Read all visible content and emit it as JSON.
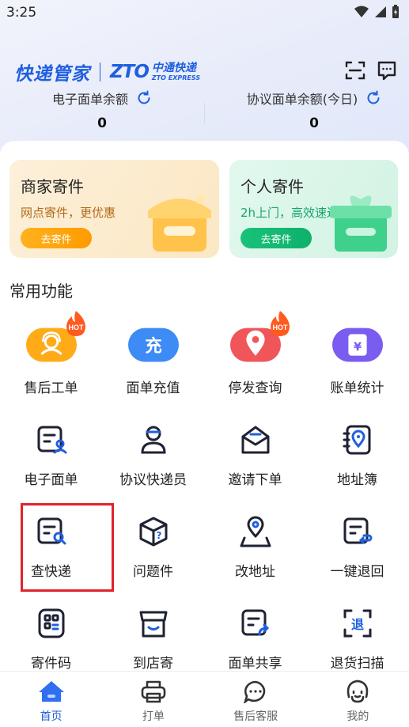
{
  "status_bar": {
    "time": "3:25"
  },
  "header": {
    "brand_name": "快递管家",
    "brand_zto": "ZTO",
    "brand_cn": "中通快递",
    "brand_en": "ZTO EXPRESS"
  },
  "balances": {
    "electronic_label": "电子面单余额",
    "electronic_value": "0",
    "agreement_label": "协议面单余额(今日)",
    "agreement_value": "0"
  },
  "promos": {
    "merchant": {
      "title": "商家寄件",
      "subtitle": "网点寄件，更优惠",
      "button": "去寄件"
    },
    "personal": {
      "title": "个人寄件",
      "subtitle": "2h上门，高效速达",
      "button": "去寄件"
    }
  },
  "functions": {
    "title": "常用功能",
    "hot_badge": "HOT",
    "charge_glyph": "充",
    "bill_glyph": "¥",
    "return_glyph": "退",
    "items": [
      {
        "label": "售后工单",
        "icon": "headset-icon",
        "hot": true
      },
      {
        "label": "面单充值",
        "icon": "recharge-icon",
        "hot": false
      },
      {
        "label": "停发查询",
        "icon": "location-pin-icon",
        "hot": true
      },
      {
        "label": "账单统计",
        "icon": "bill-icon",
        "hot": false
      },
      {
        "label": "电子面单",
        "icon": "e-waybill-icon",
        "hot": false
      },
      {
        "label": "协议快递员",
        "icon": "courier-icon",
        "hot": false
      },
      {
        "label": "邀请下单",
        "icon": "invite-mail-icon",
        "hot": false
      },
      {
        "label": "地址簿",
        "icon": "address-book-icon",
        "hot": false
      },
      {
        "label": "查快递",
        "icon": "search-parcel-icon",
        "hot": false
      },
      {
        "label": "问题件",
        "icon": "problem-parcel-icon",
        "hot": false
      },
      {
        "label": "改地址",
        "icon": "change-address-icon",
        "hot": false
      },
      {
        "label": "一键退回",
        "icon": "return-icon",
        "hot": false
      },
      {
        "label": "寄件码",
        "icon": "send-code-icon",
        "hot": false
      },
      {
        "label": "到店寄",
        "icon": "store-icon",
        "hot": false
      },
      {
        "label": "面单共享",
        "icon": "share-waybill-icon",
        "hot": false
      },
      {
        "label": "退货扫描",
        "icon": "return-scan-icon",
        "hot": false
      }
    ]
  },
  "bottom_nav": {
    "items": [
      {
        "label": "首页",
        "icon": "home-icon",
        "active": true
      },
      {
        "label": "打单",
        "icon": "printer-icon",
        "active": false
      },
      {
        "label": "售后客服",
        "icon": "chat-service-icon",
        "active": false
      },
      {
        "label": "我的",
        "icon": "profile-icon",
        "active": false
      }
    ]
  },
  "colors": {
    "brand_blue": "#1f5fe0",
    "highlight_red": "#e0232a",
    "merchant_orange": "#ff9a00",
    "personal_green": "#18c27a"
  }
}
